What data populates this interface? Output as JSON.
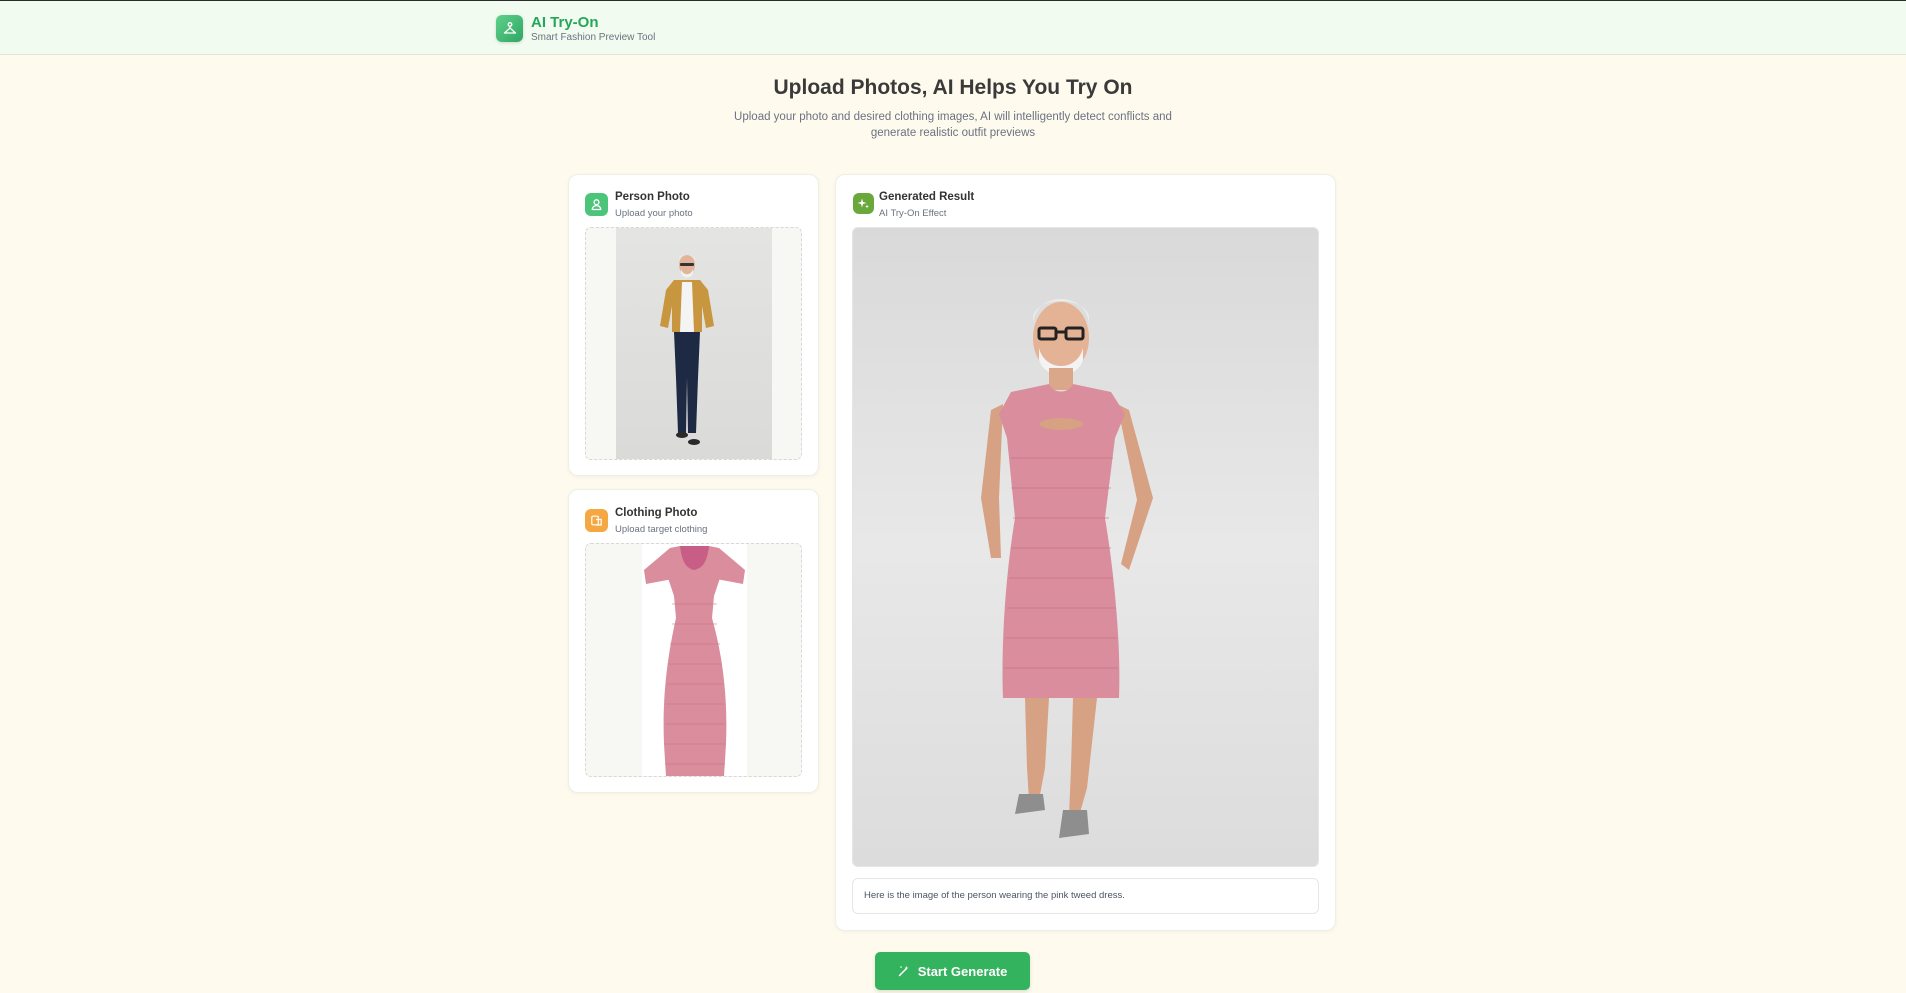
{
  "header": {
    "app_title": "AI Try-On",
    "app_subtitle": "Smart Fashion Preview Tool",
    "logo_icon": "hanger-icon"
  },
  "hero": {
    "title": "Upload Photos, AI Helps You Try On",
    "description": "Upload your photo and desired clothing images, AI will intelligently detect conflicts and generate realistic outfit previews"
  },
  "person_card": {
    "title": "Person Photo",
    "subtitle": "Upload your photo",
    "icon": "user-icon"
  },
  "clothing_card": {
    "title": "Clothing Photo",
    "subtitle": "Upload target clothing",
    "icon": "shirt-icon"
  },
  "result_card": {
    "title": "Generated Result",
    "subtitle": "AI Try-On Effect",
    "icon": "sparkle-icon",
    "result_text": "Here is the image of the person wearing the pink tweed dress."
  },
  "actions": {
    "generate_label": "Start Generate",
    "generate_icon": "magic-wand-icon"
  },
  "colors": {
    "accent": "#34b35e",
    "background": "#fefbee",
    "header_bg": "#f2fbef",
    "person_icon_bg": "#4cc47a",
    "clothing_icon_bg": "#f5a742",
    "result_icon_bg": "#6aa83c",
    "dress_pink": "#d98d9d"
  }
}
